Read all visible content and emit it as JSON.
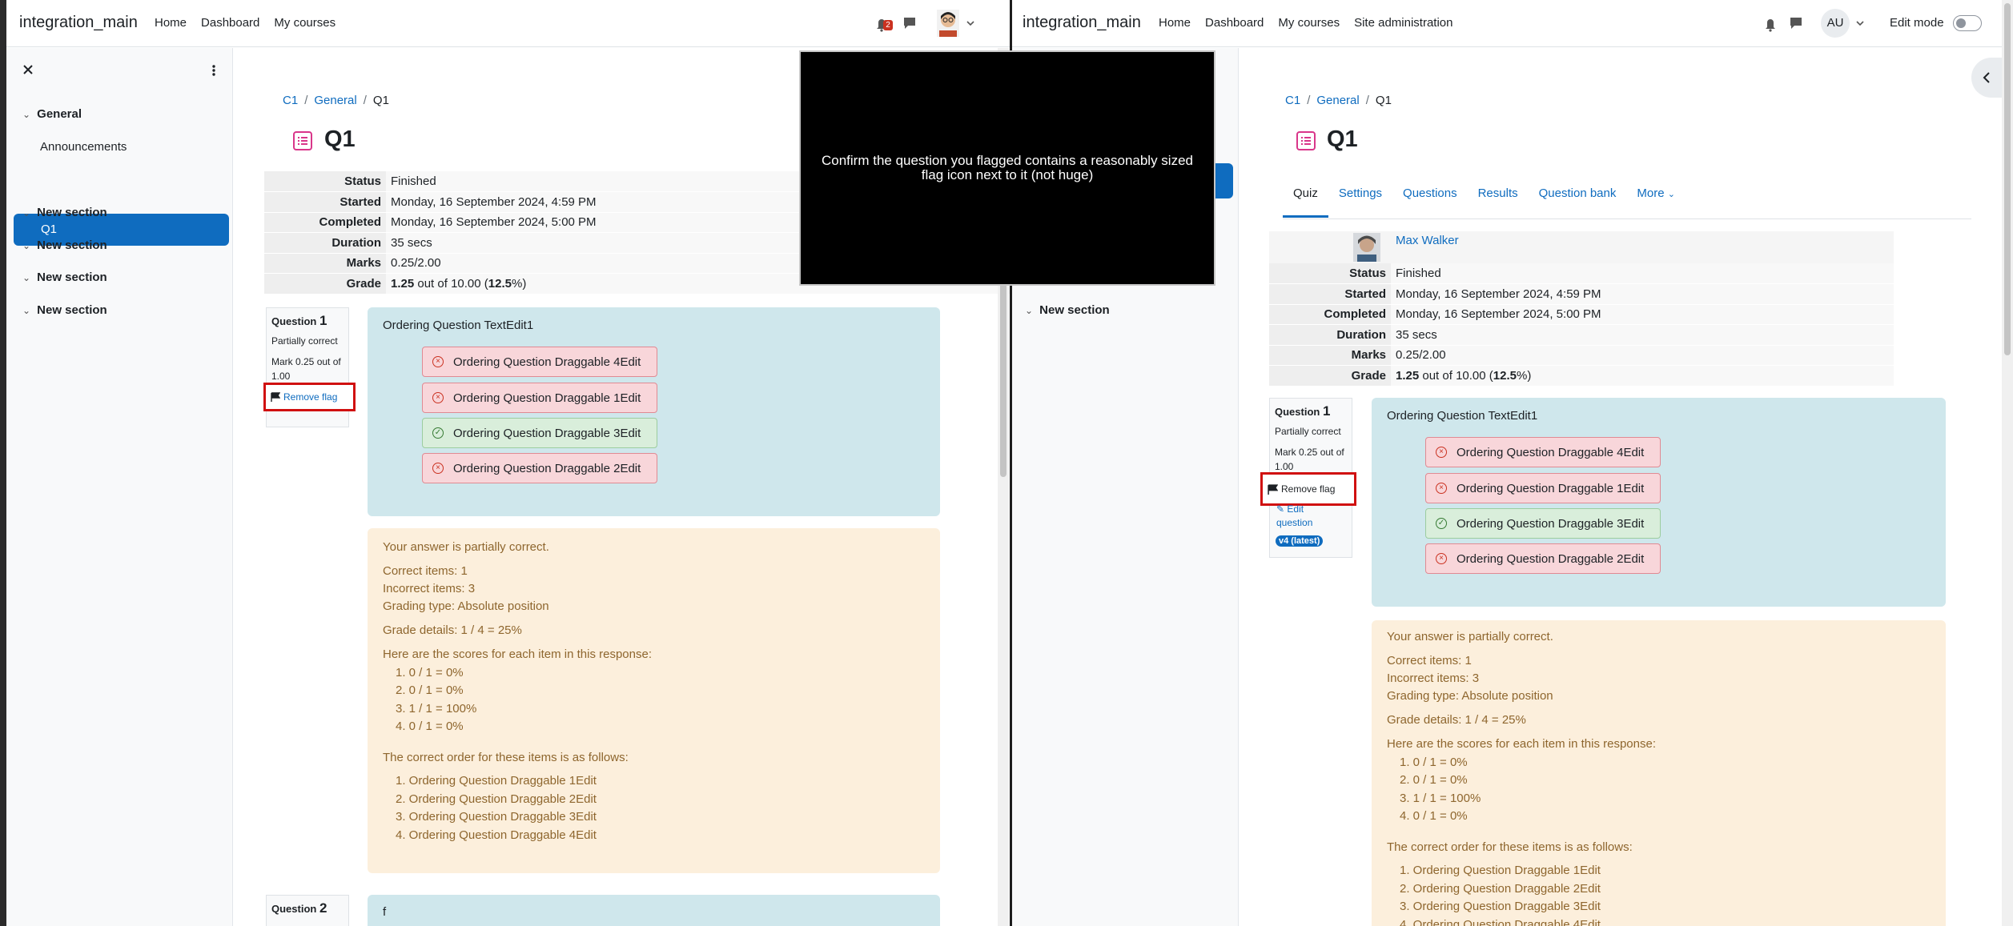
{
  "left": {
    "brand": "integration_main",
    "nav": [
      "Home",
      "Dashboard",
      "My courses"
    ],
    "notif_count": "2",
    "drawer": {
      "sections": [
        "General",
        "New section",
        "New section",
        "New section",
        "New section"
      ],
      "items": [
        "Announcements",
        "Q1"
      ]
    },
    "breadcrumb": [
      "C1",
      "General",
      "Q1"
    ],
    "title": "Q1",
    "summary": [
      {
        "k": "Status",
        "v": "Finished"
      },
      {
        "k": "Started",
        "v": "Monday, 16 September 2024, 4:59 PM"
      },
      {
        "k": "Completed",
        "v": "Monday, 16 September 2024, 5:00 PM"
      },
      {
        "k": "Duration",
        "v": "35 secs"
      },
      {
        "k": "Marks",
        "v": "0.25/2.00"
      },
      {
        "k": "Grade",
        "v_bold": "1.25",
        "v_rest": " out of 10.00 (",
        "v_pct": "12.5",
        "v_end": "%)"
      }
    ],
    "question": {
      "word": "Question",
      "number": "1",
      "state": "Partially correct",
      "mark": "Mark 0.25 out of 1.00",
      "flag_label": "Remove flag",
      "text": "Ordering Question TextEdit1"
    },
    "question2": {
      "word": "Question",
      "number": "2",
      "text": "f"
    }
  },
  "answers": [
    {
      "label": "Ordering Question Draggable 4Edit",
      "correct": false
    },
    {
      "label": "Ordering Question Draggable 1Edit",
      "correct": false
    },
    {
      "label": "Ordering Question Draggable 3Edit",
      "correct": true
    },
    {
      "label": "Ordering Question Draggable 2Edit",
      "correct": false
    }
  ],
  "feedback": {
    "summary": "Your answer is partially correct.",
    "correct_items": "Correct items: 1",
    "incorrect_items": "Incorrect items: 3",
    "grading_type": "Grading type: Absolute position",
    "grade_details": "Grade details: 1 / 4 = 25%",
    "scores_intro": "Here are the scores for each item in this response:",
    "scores": [
      "1. 0 / 1 = 0%",
      "2. 0 / 1 = 0%",
      "3. 1 / 1 = 100%",
      "4. 0 / 1 = 0%"
    ],
    "order_intro": "The correct order for these items is as follows:",
    "order": [
      "1. Ordering Question Draggable 1Edit",
      "2. Ordering Question Draggable 2Edit",
      "3. Ordering Question Draggable 3Edit",
      "4. Ordering Question Draggable 4Edit"
    ]
  },
  "tooltip": "Confirm the question you flagged contains a reasonably sized flag icon next to it (not huge)",
  "right": {
    "brand": "integration_main",
    "nav": [
      "Home",
      "Dashboard",
      "My courses",
      "Site administration"
    ],
    "avatar": "AU",
    "edit_mode": "Edit mode",
    "drawer_section": "New section",
    "breadcrumb": [
      "C1",
      "General",
      "Q1"
    ],
    "title": "Q1",
    "tabs": [
      "Quiz",
      "Settings",
      "Questions",
      "Results",
      "Question bank",
      "More"
    ],
    "user": "Max Walker",
    "summary": [
      {
        "k": "Status",
        "v": "Finished"
      },
      {
        "k": "Started",
        "v": "Monday, 16 September 2024, 4:59 PM"
      },
      {
        "k": "Completed",
        "v": "Monday, 16 September 2024, 5:00 PM"
      },
      {
        "k": "Duration",
        "v": "35 secs"
      },
      {
        "k": "Marks",
        "v": "0.25/2.00"
      },
      {
        "k": "Grade",
        "v_bold": "1.25",
        "v_rest": " out of 10.00 (",
        "v_pct": "12.5",
        "v_end": "%)"
      }
    ],
    "question": {
      "word": "Question",
      "number": "1",
      "state": "Partially correct",
      "mark": "Mark 0.25 out of 1.00",
      "flag_label": "Remove flag",
      "edit_label": "Edit question",
      "version": "v4 (latest)",
      "text": "Ordering Question TextEdit1"
    }
  },
  "colors": {
    "primary": "#0f6cbf",
    "incorrect": "#ca3120",
    "correct": "#357a32",
    "flag_highlight": "#d01010",
    "feedback_text": "#8e662e"
  }
}
